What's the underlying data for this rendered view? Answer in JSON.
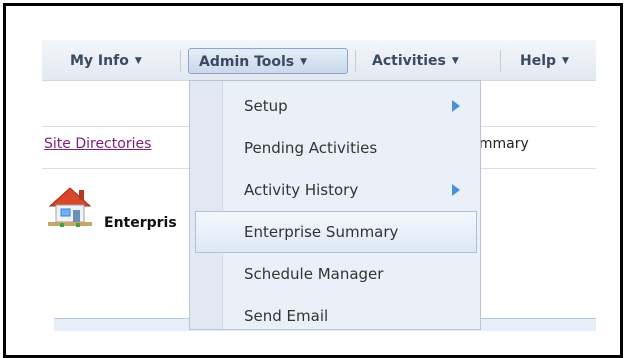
{
  "nav": {
    "my_info": "My Info",
    "admin_tools": "Admin Tools",
    "activities": "Activities",
    "help": "Help",
    "caret": "▼"
  },
  "breadcrumb": {
    "link": "Site Directories",
    "tail": "ummary"
  },
  "page": {
    "title": "Enterpris"
  },
  "menu": {
    "items": [
      {
        "label": "Setup",
        "submenu": true
      },
      {
        "label": "Pending Activities",
        "submenu": false
      },
      {
        "label": "Activity History",
        "submenu": true
      },
      {
        "label": "Enterprise Summary",
        "submenu": false,
        "highlighted": true
      },
      {
        "label": "Schedule Manager",
        "submenu": false
      },
      {
        "label": "Send Email",
        "submenu": false
      }
    ]
  },
  "icons": {
    "home": "house-icon",
    "submenu_arrow": "triangle-right-icon"
  },
  "colors": {
    "link": "#7c1f7c",
    "arrow": "#4b8fd8",
    "nav_text": "#3a4a63"
  }
}
